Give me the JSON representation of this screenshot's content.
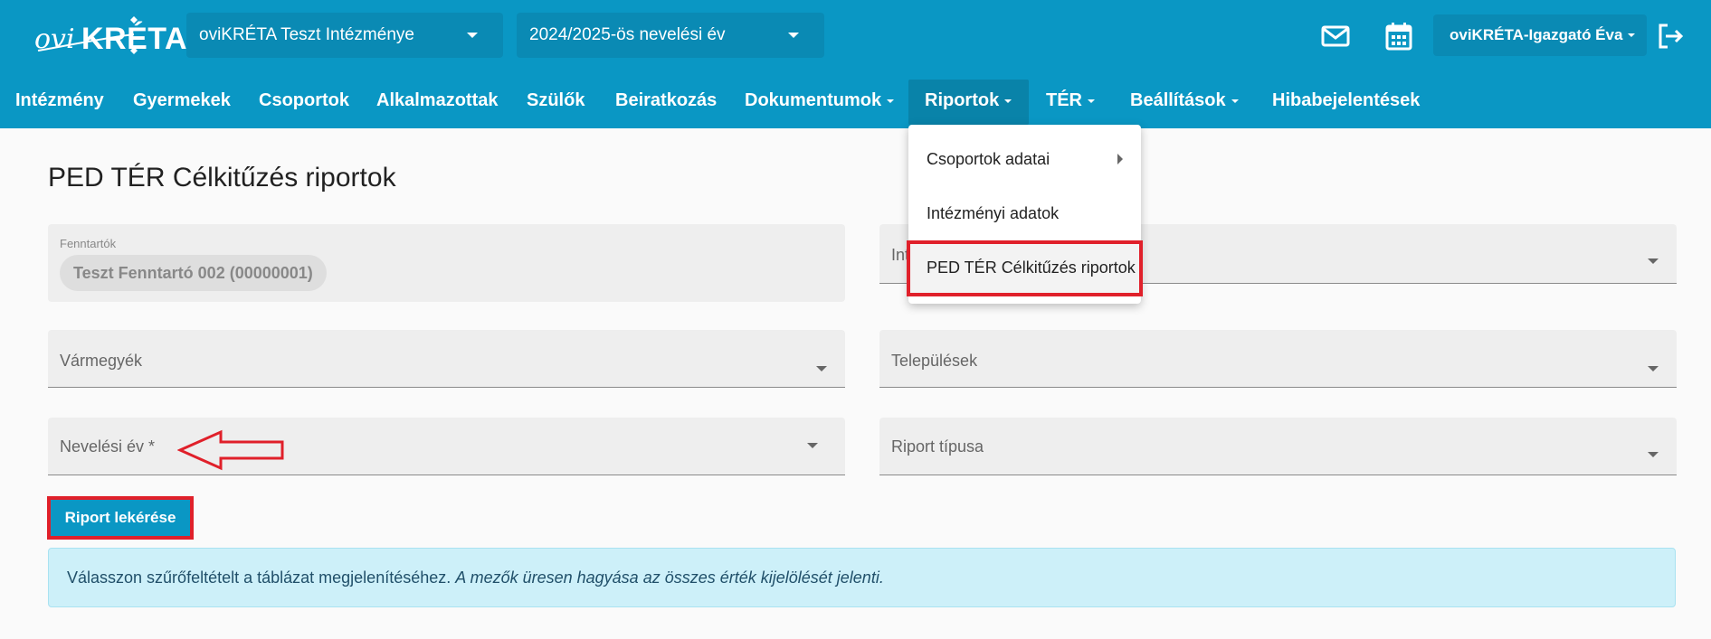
{
  "header": {
    "logo_ovi": "ovi",
    "logo_kreta": "KRÉTA",
    "institution": "oviKRÉTA Teszt Intézménye",
    "school_year": "2024/2025-ös nevelési év",
    "user": "oviKRÉTA-Igazgató Éva",
    "icons": [
      "mail-icon",
      "calendar-icon",
      "logout-icon"
    ]
  },
  "nav": {
    "items": [
      {
        "label": "Intézmény"
      },
      {
        "label": "Gyermekek"
      },
      {
        "label": "Csoportok"
      },
      {
        "label": "Alkalmazottak"
      },
      {
        "label": "Szülők"
      },
      {
        "label": "Beiratkozás"
      },
      {
        "label": "Dokumentumok"
      },
      {
        "label": "Riportok"
      },
      {
        "label": "TÉR"
      },
      {
        "label": "Beállítások"
      },
      {
        "label": "Hibabejelentések"
      }
    ],
    "active": "Riportok"
  },
  "dropdown": {
    "items": [
      {
        "label": "Csoportok adatai"
      },
      {
        "label": "Intézményi adatok"
      },
      {
        "label": "PED TÉR Célkitűzés riportok"
      }
    ]
  },
  "page": {
    "title": "PED TÉR Célkitűzés riportok",
    "fenntartok_label": "Fenntartók",
    "fenntartok_chip": "Teszt Fenntartó 002 (00000001)",
    "intezmeny_label_partial": "Int",
    "varmegyek_label": "Vármegyék",
    "telepulesek_label": "Települések",
    "nevelesi_ev_label": "Nevelési év *",
    "riport_tipusa_label": "Riport típusa",
    "button_label": "Riport lekérése",
    "alert_text": "Válasszon szűrőfeltételt a táblázat megjelenítéséhez. ",
    "alert_italic": "A mezők üresen hagyása az összes érték kijelölését jelenti."
  },
  "colors": {
    "primary": "#0a97c4",
    "highlight_red": "#e0202a",
    "alert_bg": "#cdf0f9"
  }
}
